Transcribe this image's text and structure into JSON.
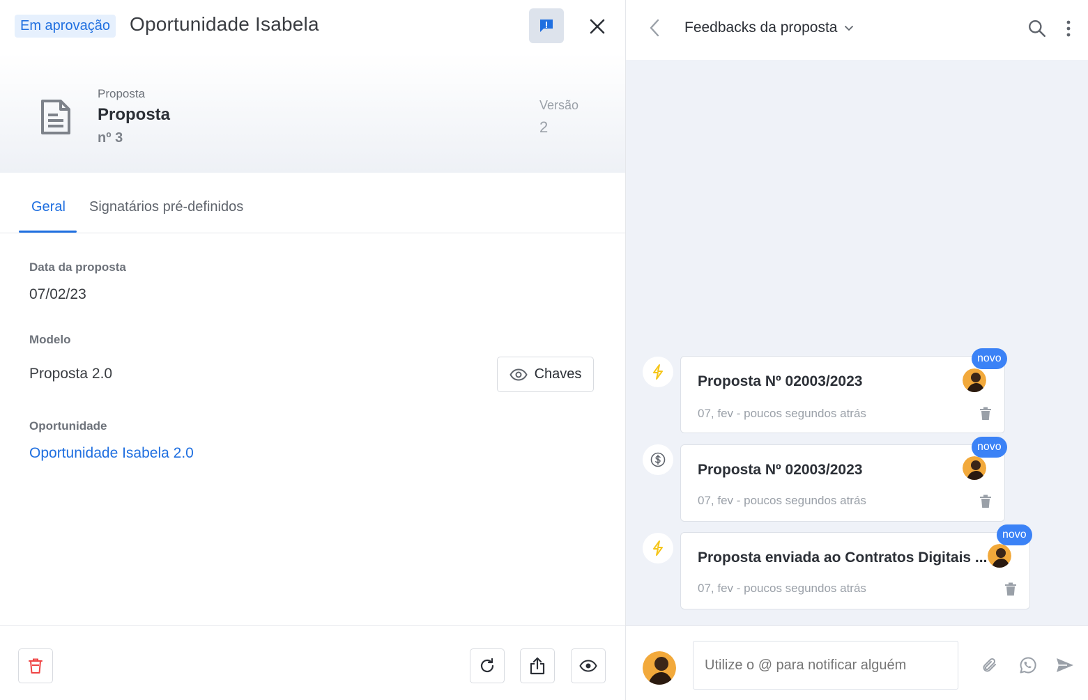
{
  "left": {
    "status_badge": "Em aprovação",
    "title": "Oportunidade Isabela",
    "icons": {
      "feedback": "feedback-alert-icon",
      "close": "close-icon",
      "document": "document-icon"
    },
    "document": {
      "kind": "Proposta",
      "name": "Proposta",
      "number": "nº 3",
      "version_label": "Versão",
      "version_value": "2"
    },
    "tabs": [
      {
        "label": "Geral",
        "active": true
      },
      {
        "label": "Signatários pré-definidos",
        "active": false
      }
    ],
    "fields": {
      "date_label": "Data da proposta",
      "date_value": "07/02/23",
      "model_label": "Modelo",
      "model_value": "Proposta 2.0",
      "keys_button": "Chaves",
      "opportunity_label": "Oportunidade",
      "opportunity_value": "Oportunidade Isabela 2.0"
    },
    "footer_icons": [
      "trash-icon",
      "refresh-icon",
      "share-icon",
      "eye-icon"
    ]
  },
  "right": {
    "title": "Feedbacks da proposta",
    "icons": {
      "back": "chevron-left-icon",
      "dropdown": "chevron-down-icon",
      "search": "search-icon",
      "more": "more-vertical-icon"
    },
    "feed": [
      {
        "icon": "lightning-icon",
        "title": "Proposta Nº 02003/2023",
        "meta": "07, fev - poucos segundos atrás",
        "badge": "novo"
      },
      {
        "icon": "dollar-icon",
        "title": "Proposta Nº 02003/2023",
        "meta": "07, fev - poucos segundos atrás",
        "badge": "novo"
      },
      {
        "icon": "lightning-icon",
        "title": "Proposta enviada ao Contratos Digitais ...",
        "meta": "07, fev - poucos segundos atrás",
        "badge": "novo"
      }
    ],
    "composer": {
      "placeholder": "Utilize o @ para notificar alguém",
      "icons": [
        "paperclip-icon",
        "whatsapp-icon",
        "send-icon"
      ]
    }
  },
  "colors": {
    "accent": "#1f6fe0",
    "badge": "#3b82f6",
    "danger": "#ef4444",
    "lightning": "#f5c518",
    "feed_bg": "#eff2f8"
  }
}
